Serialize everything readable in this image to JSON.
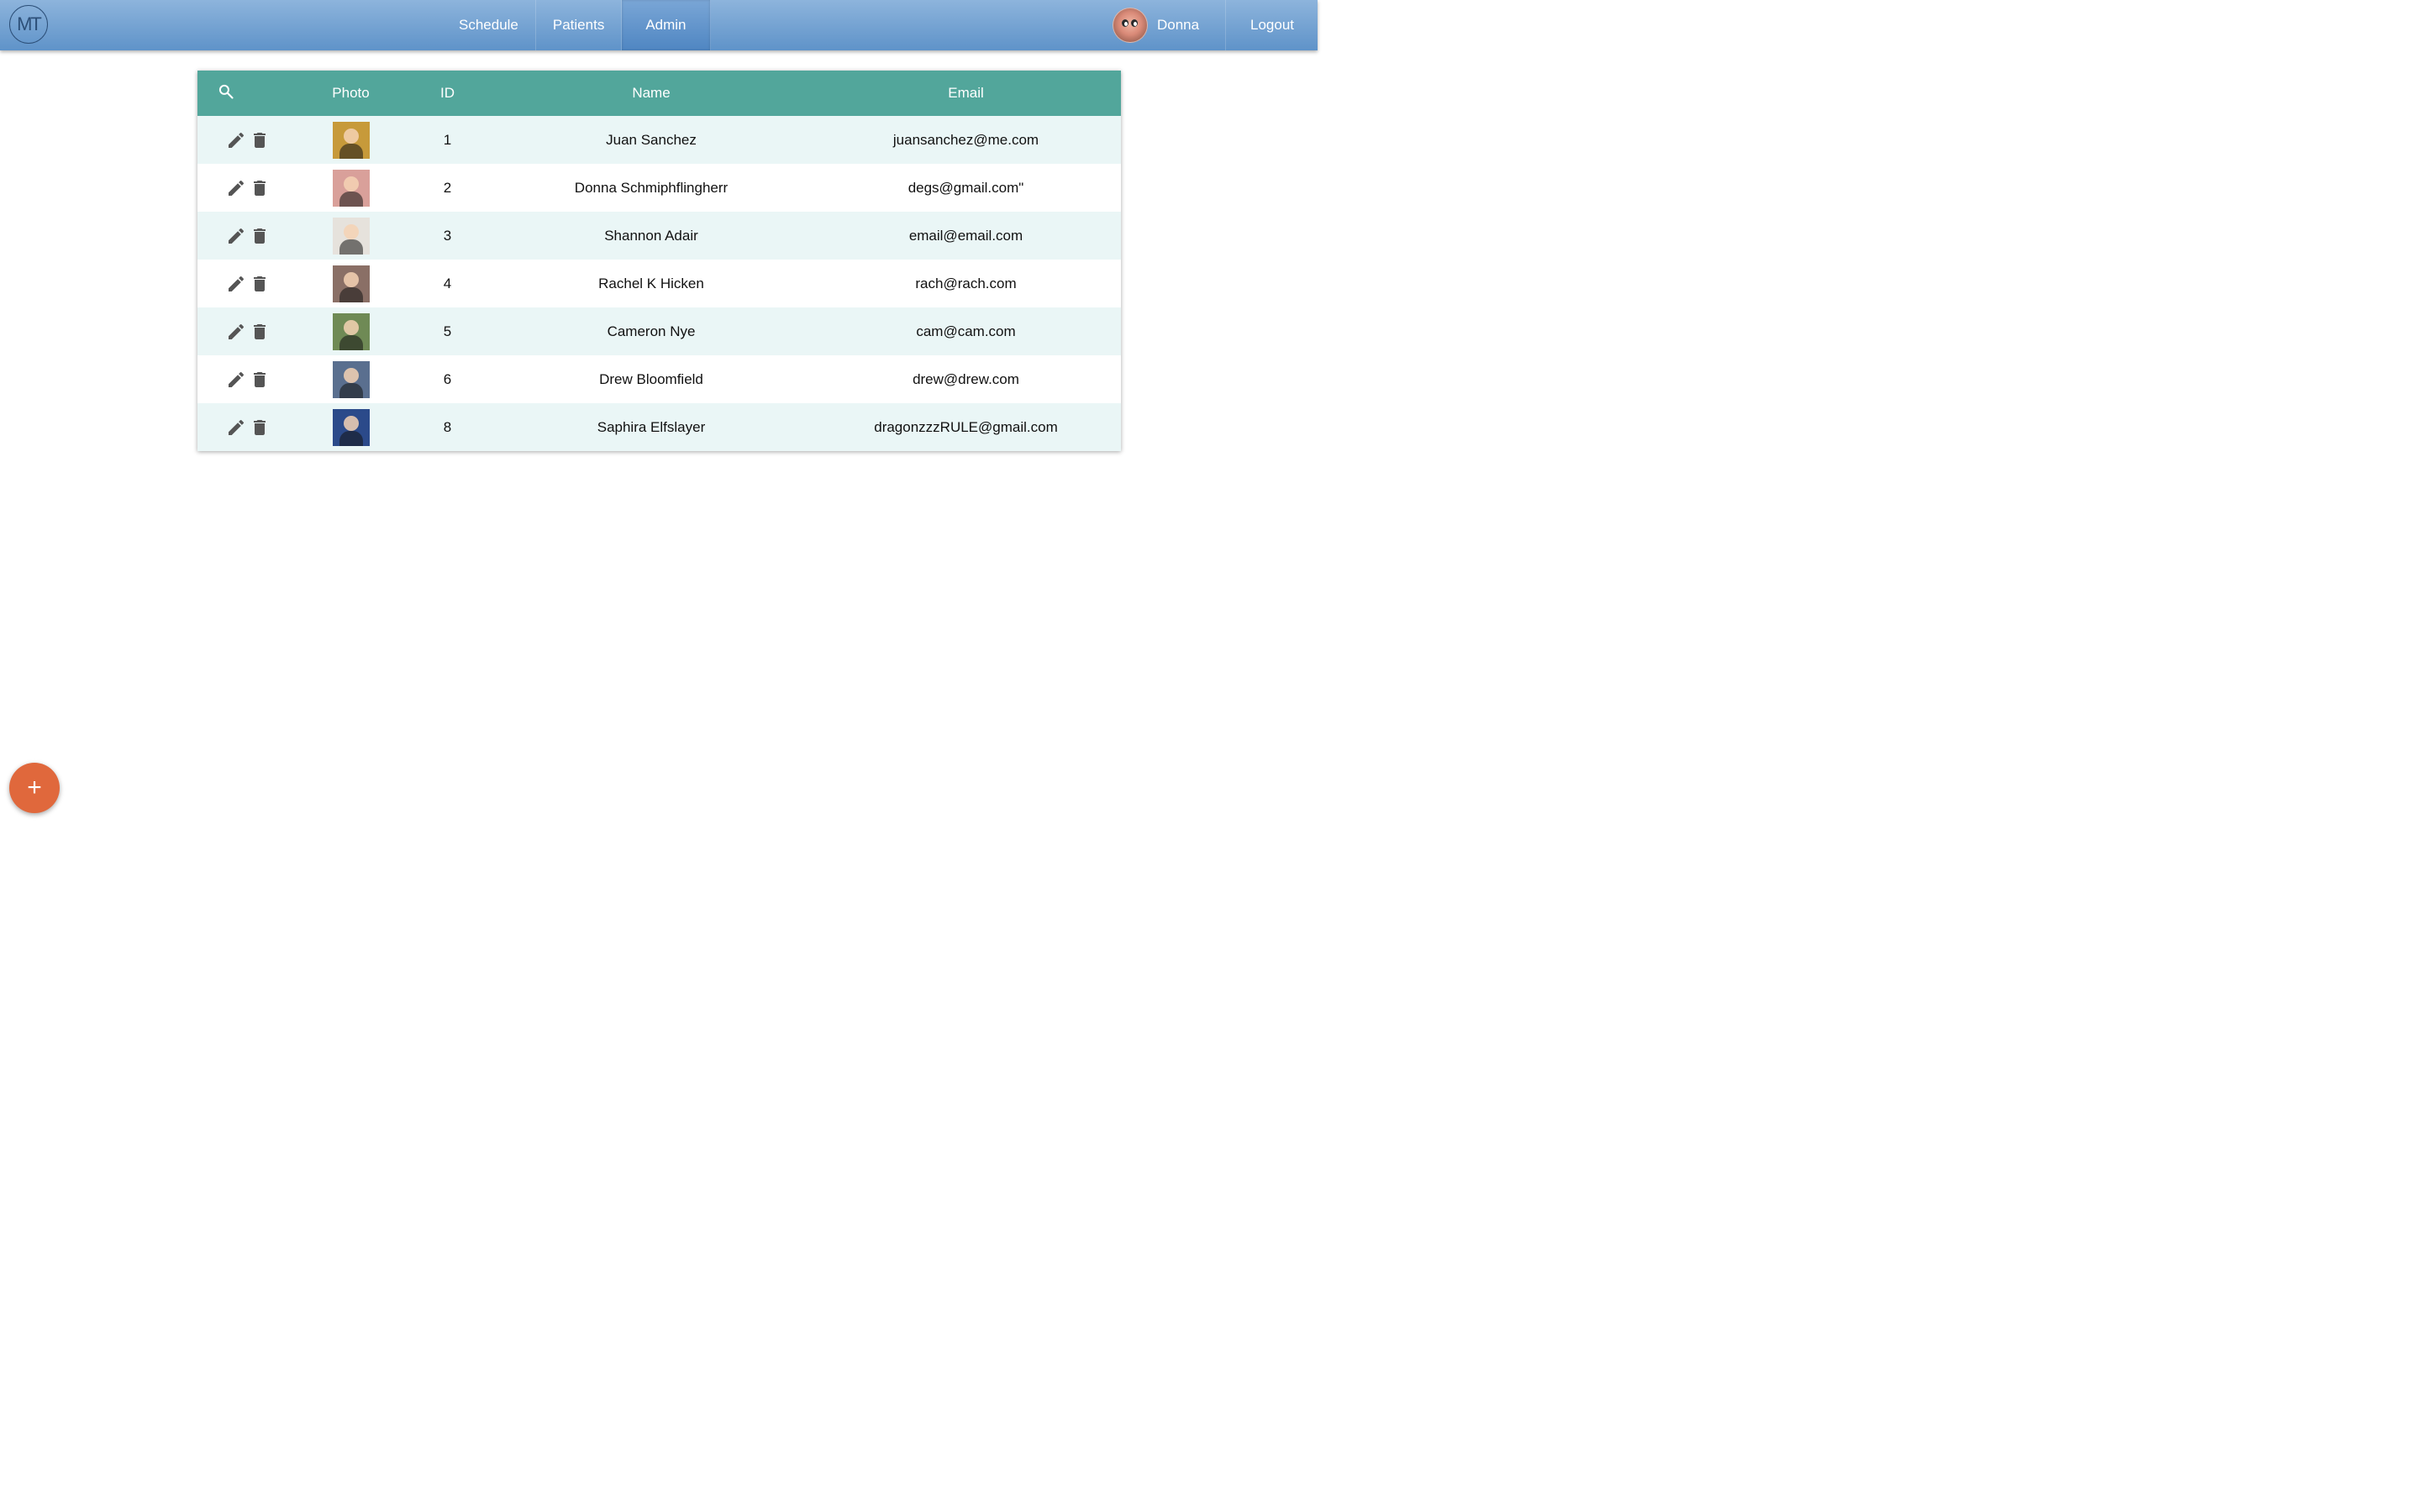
{
  "app": {
    "logo_text": "MT"
  },
  "nav": {
    "items": [
      {
        "label": "Schedule"
      },
      {
        "label": "Patients"
      },
      {
        "label": "Admin",
        "active": true
      }
    ]
  },
  "user": {
    "name": "Donna",
    "logout_label": "Logout"
  },
  "table": {
    "columns": {
      "search_icon": "search-icon",
      "photo": "Photo",
      "id": "ID",
      "name": "Name",
      "email": "Email"
    },
    "header_color": "#52a69b",
    "rows": [
      {
        "id": "1",
        "name": "Juan Sanchez",
        "email": "juansanchez@me.com",
        "photo_color": "#c79a3a"
      },
      {
        "id": "2",
        "name": "Donna Schmiphflingherr",
        "email": "degs@gmail.com\"",
        "photo_color": "#d9a09a"
      },
      {
        "id": "3",
        "name": "Shannon Adair",
        "email": "email@email.com",
        "photo_color": "#e6e2dc"
      },
      {
        "id": "4",
        "name": "Rachel K Hicken",
        "email": "rach@rach.com",
        "photo_color": "#8a6f66"
      },
      {
        "id": "5",
        "name": "Cameron Nye",
        "email": "cam@cam.com",
        "photo_color": "#6f8a55"
      },
      {
        "id": "6",
        "name": "Drew Bloomfield",
        "email": "drew@drew.com",
        "photo_color": "#5a6f8f"
      },
      {
        "id": "8",
        "name": "Saphira Elfslayer",
        "email": "dragonzzzRULE@gmail.com",
        "photo_color": "#2b4a8a"
      }
    ]
  },
  "fab": {
    "label": "+"
  },
  "colors": {
    "topbar": "#6b9fd2",
    "accent": "#e0683c",
    "row_alt": "#eaf6f6",
    "icon": "#555555"
  }
}
